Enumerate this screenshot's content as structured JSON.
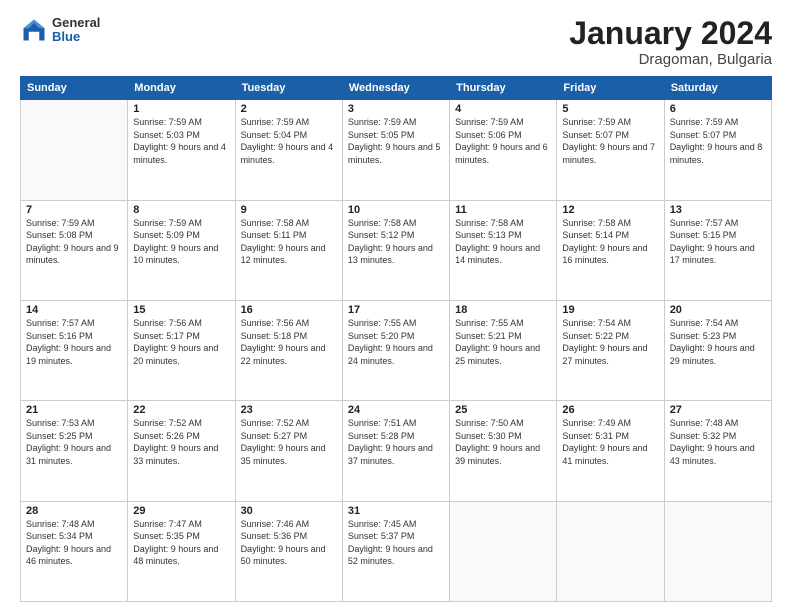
{
  "logo": {
    "general": "General",
    "blue": "Blue"
  },
  "header": {
    "title": "January 2024",
    "subtitle": "Dragoman, Bulgaria"
  },
  "weekdays": [
    "Sunday",
    "Monday",
    "Tuesday",
    "Wednesday",
    "Thursday",
    "Friday",
    "Saturday"
  ],
  "weeks": [
    [
      {
        "day": null,
        "sunrise": null,
        "sunset": null,
        "daylight": null
      },
      {
        "day": "1",
        "sunrise": "Sunrise: 7:59 AM",
        "sunset": "Sunset: 5:03 PM",
        "daylight": "Daylight: 9 hours and 4 minutes."
      },
      {
        "day": "2",
        "sunrise": "Sunrise: 7:59 AM",
        "sunset": "Sunset: 5:04 PM",
        "daylight": "Daylight: 9 hours and 4 minutes."
      },
      {
        "day": "3",
        "sunrise": "Sunrise: 7:59 AM",
        "sunset": "Sunset: 5:05 PM",
        "daylight": "Daylight: 9 hours and 5 minutes."
      },
      {
        "day": "4",
        "sunrise": "Sunrise: 7:59 AM",
        "sunset": "Sunset: 5:06 PM",
        "daylight": "Daylight: 9 hours and 6 minutes."
      },
      {
        "day": "5",
        "sunrise": "Sunrise: 7:59 AM",
        "sunset": "Sunset: 5:07 PM",
        "daylight": "Daylight: 9 hours and 7 minutes."
      },
      {
        "day": "6",
        "sunrise": "Sunrise: 7:59 AM",
        "sunset": "Sunset: 5:07 PM",
        "daylight": "Daylight: 9 hours and 8 minutes."
      }
    ],
    [
      {
        "day": "7",
        "sunrise": "Sunrise: 7:59 AM",
        "sunset": "Sunset: 5:08 PM",
        "daylight": "Daylight: 9 hours and 9 minutes."
      },
      {
        "day": "8",
        "sunrise": "Sunrise: 7:59 AM",
        "sunset": "Sunset: 5:09 PM",
        "daylight": "Daylight: 9 hours and 10 minutes."
      },
      {
        "day": "9",
        "sunrise": "Sunrise: 7:58 AM",
        "sunset": "Sunset: 5:11 PM",
        "daylight": "Daylight: 9 hours and 12 minutes."
      },
      {
        "day": "10",
        "sunrise": "Sunrise: 7:58 AM",
        "sunset": "Sunset: 5:12 PM",
        "daylight": "Daylight: 9 hours and 13 minutes."
      },
      {
        "day": "11",
        "sunrise": "Sunrise: 7:58 AM",
        "sunset": "Sunset: 5:13 PM",
        "daylight": "Daylight: 9 hours and 14 minutes."
      },
      {
        "day": "12",
        "sunrise": "Sunrise: 7:58 AM",
        "sunset": "Sunset: 5:14 PM",
        "daylight": "Daylight: 9 hours and 16 minutes."
      },
      {
        "day": "13",
        "sunrise": "Sunrise: 7:57 AM",
        "sunset": "Sunset: 5:15 PM",
        "daylight": "Daylight: 9 hours and 17 minutes."
      }
    ],
    [
      {
        "day": "14",
        "sunrise": "Sunrise: 7:57 AM",
        "sunset": "Sunset: 5:16 PM",
        "daylight": "Daylight: 9 hours and 19 minutes."
      },
      {
        "day": "15",
        "sunrise": "Sunrise: 7:56 AM",
        "sunset": "Sunset: 5:17 PM",
        "daylight": "Daylight: 9 hours and 20 minutes."
      },
      {
        "day": "16",
        "sunrise": "Sunrise: 7:56 AM",
        "sunset": "Sunset: 5:18 PM",
        "daylight": "Daylight: 9 hours and 22 minutes."
      },
      {
        "day": "17",
        "sunrise": "Sunrise: 7:55 AM",
        "sunset": "Sunset: 5:20 PM",
        "daylight": "Daylight: 9 hours and 24 minutes."
      },
      {
        "day": "18",
        "sunrise": "Sunrise: 7:55 AM",
        "sunset": "Sunset: 5:21 PM",
        "daylight": "Daylight: 9 hours and 25 minutes."
      },
      {
        "day": "19",
        "sunrise": "Sunrise: 7:54 AM",
        "sunset": "Sunset: 5:22 PM",
        "daylight": "Daylight: 9 hours and 27 minutes."
      },
      {
        "day": "20",
        "sunrise": "Sunrise: 7:54 AM",
        "sunset": "Sunset: 5:23 PM",
        "daylight": "Daylight: 9 hours and 29 minutes."
      }
    ],
    [
      {
        "day": "21",
        "sunrise": "Sunrise: 7:53 AM",
        "sunset": "Sunset: 5:25 PM",
        "daylight": "Daylight: 9 hours and 31 minutes."
      },
      {
        "day": "22",
        "sunrise": "Sunrise: 7:52 AM",
        "sunset": "Sunset: 5:26 PM",
        "daylight": "Daylight: 9 hours and 33 minutes."
      },
      {
        "day": "23",
        "sunrise": "Sunrise: 7:52 AM",
        "sunset": "Sunset: 5:27 PM",
        "daylight": "Daylight: 9 hours and 35 minutes."
      },
      {
        "day": "24",
        "sunrise": "Sunrise: 7:51 AM",
        "sunset": "Sunset: 5:28 PM",
        "daylight": "Daylight: 9 hours and 37 minutes."
      },
      {
        "day": "25",
        "sunrise": "Sunrise: 7:50 AM",
        "sunset": "Sunset: 5:30 PM",
        "daylight": "Daylight: 9 hours and 39 minutes."
      },
      {
        "day": "26",
        "sunrise": "Sunrise: 7:49 AM",
        "sunset": "Sunset: 5:31 PM",
        "daylight": "Daylight: 9 hours and 41 minutes."
      },
      {
        "day": "27",
        "sunrise": "Sunrise: 7:48 AM",
        "sunset": "Sunset: 5:32 PM",
        "daylight": "Daylight: 9 hours and 43 minutes."
      }
    ],
    [
      {
        "day": "28",
        "sunrise": "Sunrise: 7:48 AM",
        "sunset": "Sunset: 5:34 PM",
        "daylight": "Daylight: 9 hours and 46 minutes."
      },
      {
        "day": "29",
        "sunrise": "Sunrise: 7:47 AM",
        "sunset": "Sunset: 5:35 PM",
        "daylight": "Daylight: 9 hours and 48 minutes."
      },
      {
        "day": "30",
        "sunrise": "Sunrise: 7:46 AM",
        "sunset": "Sunset: 5:36 PM",
        "daylight": "Daylight: 9 hours and 50 minutes."
      },
      {
        "day": "31",
        "sunrise": "Sunrise: 7:45 AM",
        "sunset": "Sunset: 5:37 PM",
        "daylight": "Daylight: 9 hours and 52 minutes."
      },
      {
        "day": null,
        "sunrise": null,
        "sunset": null,
        "daylight": null
      },
      {
        "day": null,
        "sunrise": null,
        "sunset": null,
        "daylight": null
      },
      {
        "day": null,
        "sunrise": null,
        "sunset": null,
        "daylight": null
      }
    ]
  ]
}
